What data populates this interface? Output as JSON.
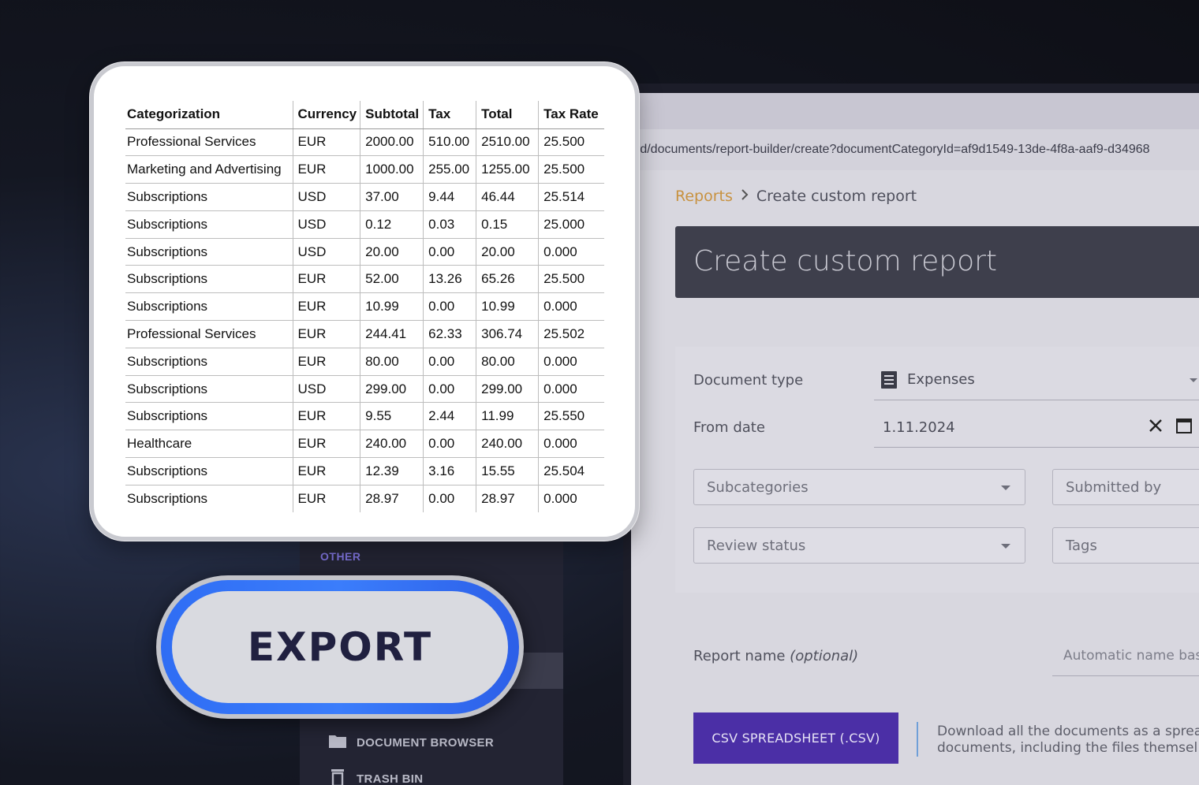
{
  "browser": {
    "url": "rd/documents/report-builder/create?documentCategoryId=af9d1549-13de-4f8a-aaf9-d34968"
  },
  "breadcrumb": {
    "parent": "Reports",
    "separator": ">",
    "current": "Create custom report"
  },
  "page": {
    "title": "Create custom report"
  },
  "form": {
    "document_type": {
      "label": "Document type",
      "value": "Expenses",
      "icon": "document-list-icon"
    },
    "from_date": {
      "label": "From date",
      "value": "1.11.2024",
      "clear_symbol": "✕"
    },
    "subcategories": {
      "placeholder": "Subcategories"
    },
    "submitted_by": {
      "placeholder": "Submitted by"
    },
    "review_status": {
      "placeholder": "Review status"
    },
    "tags": {
      "placeholder": "Tags"
    },
    "report_name": {
      "label": "Report name",
      "label_suffix": "(optional)",
      "placeholder": "Automatic name bas"
    },
    "csv_button": "CSV SPREADSHEET (.CSV)",
    "csv_description_line1": "Download all the documents as a sprea",
    "csv_description_line2": "documents, including the files themsel"
  },
  "sidebar": {
    "section_other": "OTHER",
    "items": [
      {
        "label": "DOCUMENT BROWSER",
        "icon": "folder-icon"
      },
      {
        "label": "TRASH BIN",
        "icon": "trash-icon"
      }
    ]
  },
  "export_label": "EXPORT",
  "table": {
    "headers": [
      "Categorization",
      "Currency",
      "Subtotal",
      "Tax",
      "Total",
      "Tax Rate"
    ],
    "rows": [
      [
        "Professional Services",
        "EUR",
        "2000.00",
        "510.00",
        "2510.00",
        "25.500"
      ],
      [
        "Marketing and Advertising",
        "EUR",
        "1000.00",
        "255.00",
        "1255.00",
        "25.500"
      ],
      [
        "Subscriptions",
        "USD",
        "37.00",
        "9.44",
        "46.44",
        "25.514"
      ],
      [
        "Subscriptions",
        "USD",
        "0.12",
        "0.03",
        "0.15",
        "25.000"
      ],
      [
        "Subscriptions",
        "USD",
        "20.00",
        "0.00",
        "20.00",
        "0.000"
      ],
      [
        "Subscriptions",
        "EUR",
        "52.00",
        "13.26",
        "65.26",
        "25.500"
      ],
      [
        "Subscriptions",
        "EUR",
        "10.99",
        "0.00",
        "10.99",
        "0.000"
      ],
      [
        "Professional Services",
        "EUR",
        "244.41",
        "62.33",
        "306.74",
        "25.502"
      ],
      [
        "Subscriptions",
        "EUR",
        "80.00",
        "0.00",
        "80.00",
        "0.000"
      ],
      [
        "Subscriptions",
        "USD",
        "299.00",
        "0.00",
        "299.00",
        "0.000"
      ],
      [
        "Subscriptions",
        "EUR",
        "9.55",
        "2.44",
        "11.99",
        "25.550"
      ],
      [
        "Healthcare",
        "EUR",
        "240.00",
        "0.00",
        "240.00",
        "0.000"
      ],
      [
        "Subscriptions",
        "EUR",
        "12.39",
        "3.16",
        "15.55",
        "25.504"
      ],
      [
        "Subscriptions",
        "EUR",
        "28.97",
        "0.00",
        "28.97",
        "0.000"
      ]
    ]
  },
  "colors": {
    "accent_purple": "#4b2fa6",
    "breadcrumb_link": "#c89240",
    "export_ring_blue": "#2f6df4",
    "sidebar_bg": "#232433"
  }
}
